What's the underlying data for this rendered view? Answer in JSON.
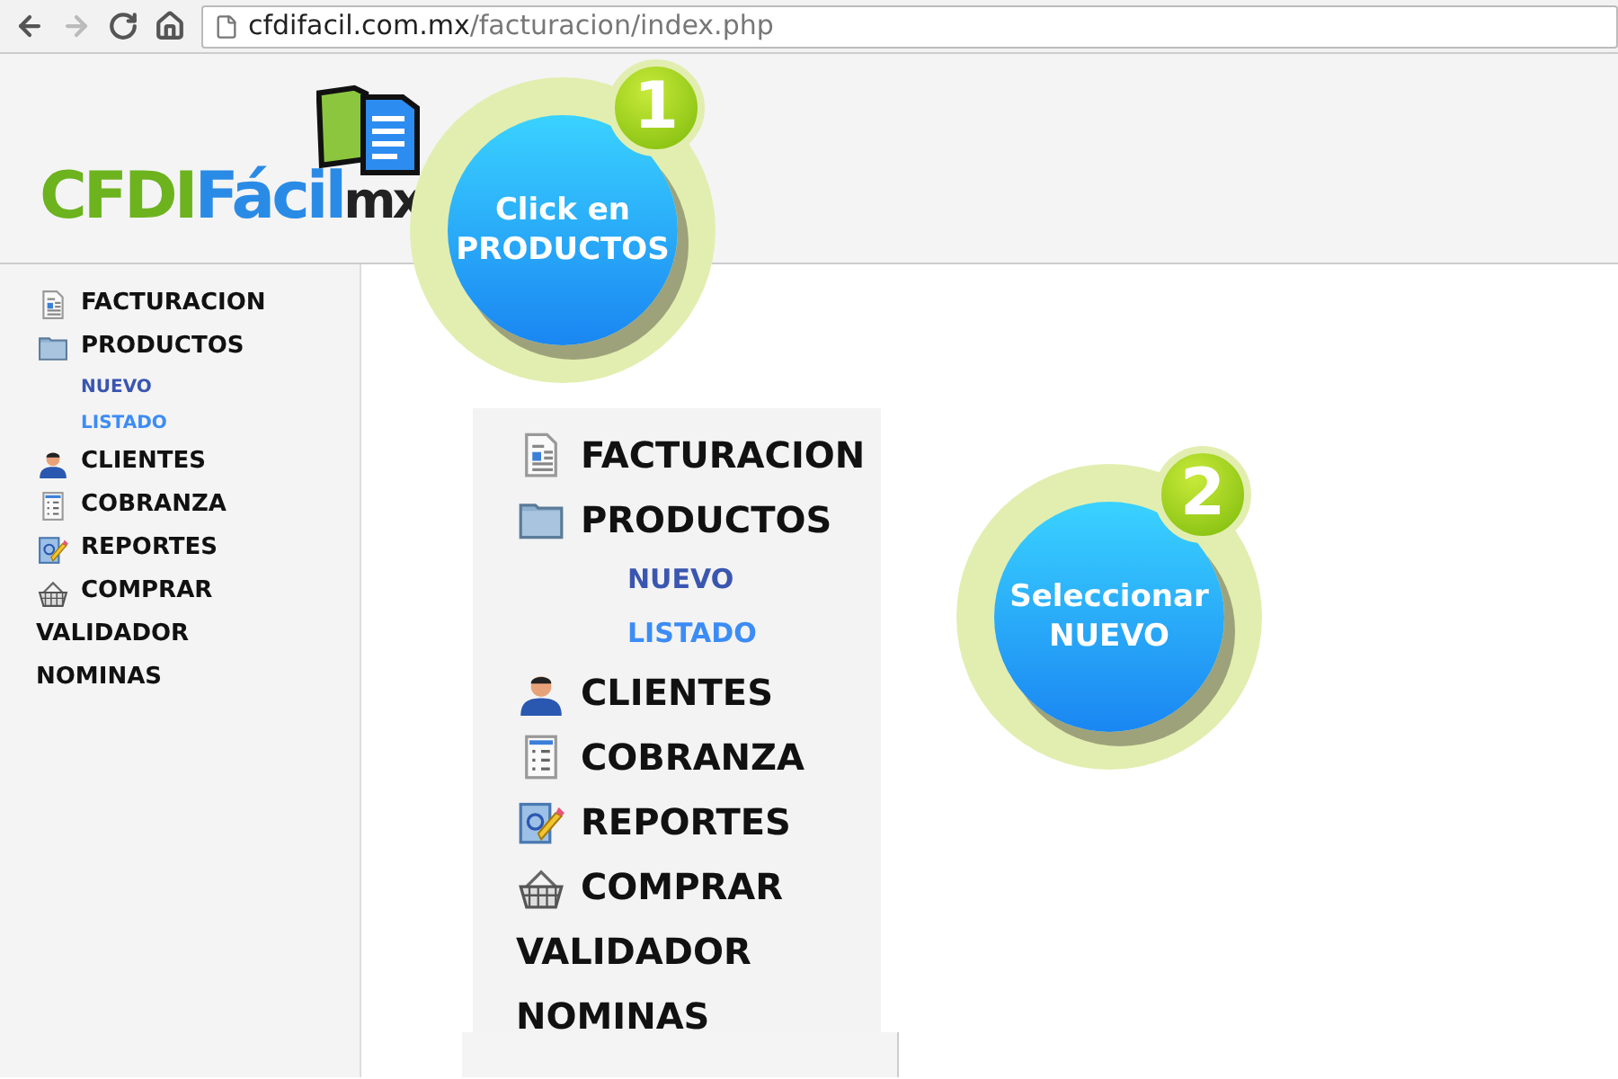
{
  "browser": {
    "url_host": "cfdifacil.com.mx",
    "url_path": "/facturacion/index.php"
  },
  "logo": {
    "part_1": "CFDI",
    "part_2": "Fácil",
    "part_3": "mx"
  },
  "sidebar": {
    "items": [
      {
        "kind": "document",
        "label": "FACTURACION"
      },
      {
        "kind": "folder",
        "label": "PRODUCTOS"
      },
      {
        "kind": "sub",
        "label": "NUEVO",
        "color": "#3a56b0"
      },
      {
        "kind": "sub",
        "label": "LISTADO",
        "color": "#3c8cf5"
      },
      {
        "kind": "person",
        "label": "CLIENTES"
      },
      {
        "kind": "list",
        "label": "COBRANZA"
      },
      {
        "kind": "report",
        "label": "REPORTES"
      },
      {
        "kind": "basket",
        "label": "COMPRAR"
      },
      {
        "kind": "plain",
        "label": "VALIDADOR"
      },
      {
        "kind": "plain",
        "label": "NOMINAS"
      }
    ]
  },
  "zoomed_menu": {
    "items": [
      {
        "kind": "document",
        "label": "FACTURACION"
      },
      {
        "kind": "folder",
        "label": "PRODUCTOS"
      },
      {
        "kind": "sub",
        "label": "NUEVO",
        "color": "#3a56b0"
      },
      {
        "kind": "sub",
        "label": "LISTADO",
        "color": "#3c8cf5"
      },
      {
        "kind": "person",
        "label": "CLIENTES"
      },
      {
        "kind": "list",
        "label": "COBRANZA"
      },
      {
        "kind": "report",
        "label": "REPORTES"
      },
      {
        "kind": "basket",
        "label": "COMPRAR"
      },
      {
        "kind": "plain",
        "label": "VALIDADOR"
      },
      {
        "kind": "plain",
        "label": "NOMINAS"
      }
    ]
  },
  "callouts": [
    {
      "number": "1",
      "line_1": "Click en",
      "line_2": "PRODUCTOS"
    },
    {
      "number": "2",
      "line_1": "Seleccionar",
      "line_2": "NUEVO"
    }
  ]
}
